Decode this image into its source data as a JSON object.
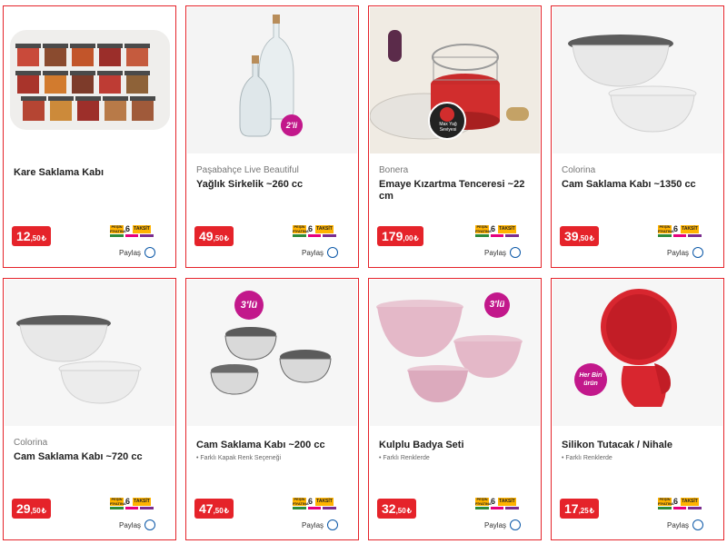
{
  "colors": {
    "accent": "#e5232a",
    "taksit_yellow": "#ffb300",
    "share_blue": "#0a57a7",
    "badge_pink": "#c2188b"
  },
  "common": {
    "share_label": "Paylaş",
    "taksit_pesin": "PEŞİN FİYATINA",
    "taksit_number": "6",
    "taksit_label": "TAKSİT",
    "currency": "₺"
  },
  "products": [
    {
      "brand": "",
      "title": "Kare Saklama Kabı",
      "note": "",
      "price_int": "12",
      "price_dec": ",50",
      "image_label": ""
    },
    {
      "brand": "Paşabahçe Live Beautiful",
      "title": "Yağlık Sirkelik ~260 cc",
      "note": "",
      "price_int": "49",
      "price_dec": ",50",
      "image_label": "2'li"
    },
    {
      "brand": "Bonera",
      "title": "Emaye Kızartma Tenceresi ~22 cm",
      "note": "",
      "price_int": "179",
      "price_dec": ",00",
      "image_label": "Max Yağ Seviyesi"
    },
    {
      "brand": "Colorina",
      "title": "Cam Saklama Kabı ~1350 cc",
      "note": "",
      "price_int": "39",
      "price_dec": ",50",
      "image_label": ""
    },
    {
      "brand": "Colorina",
      "title": "Cam Saklama Kabı ~720 cc",
      "note": "",
      "price_int": "29",
      "price_dec": ",50",
      "image_label": ""
    },
    {
      "brand": "",
      "title": "Cam Saklama Kabı ~200 cc",
      "note": "• Farklı Kapak Renk Seçeneği",
      "price_int": "47",
      "price_dec": ",50",
      "image_label": "3'lü"
    },
    {
      "brand": "",
      "title": "Kulplu Badya Seti",
      "note": "• Farklı Renklerde",
      "price_int": "32",
      "price_dec": ",50",
      "image_label": "3'lü"
    },
    {
      "brand": "",
      "title": "Silikon Tutacak / Nihale",
      "note": "• Farklı Renklerde",
      "price_int": "17",
      "price_dec": ",25",
      "image_label": "Her Biri ürün"
    }
  ]
}
